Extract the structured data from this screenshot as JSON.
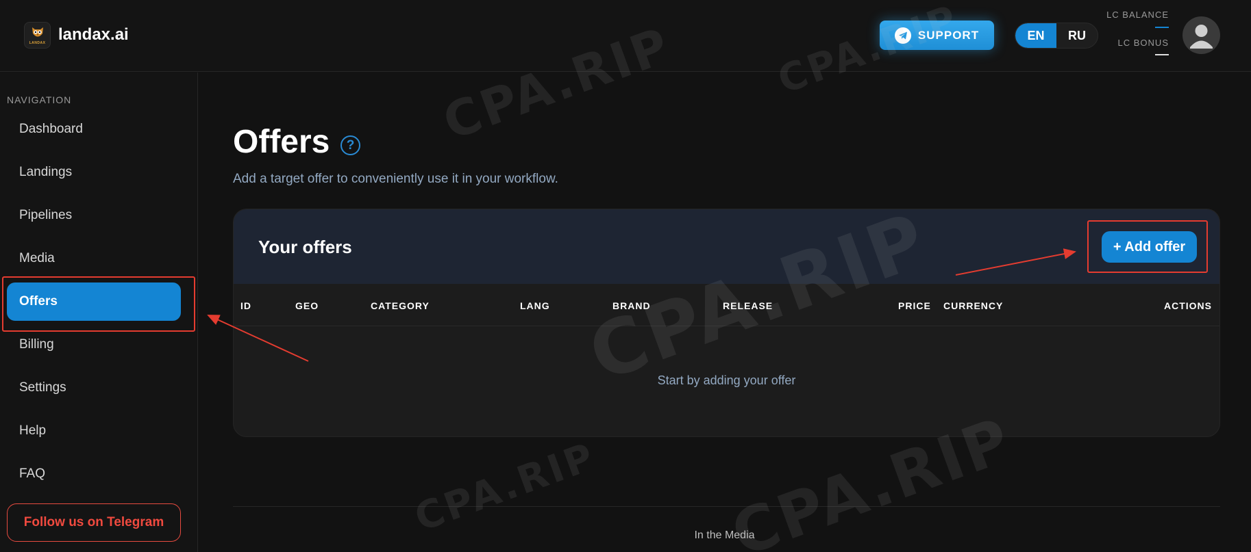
{
  "header": {
    "brand": "landax.ai",
    "logo_mini": "LANDAX",
    "support_label": "SUPPORT",
    "languages": [
      {
        "code": "EN",
        "active": true
      },
      {
        "code": "RU",
        "active": false
      }
    ],
    "lc_balance_label": "LC BALANCE",
    "lc_bonus_label": "LC BONUS"
  },
  "sidebar": {
    "title": "NAVIGATION",
    "items": [
      {
        "label": "Dashboard"
      },
      {
        "label": "Landings"
      },
      {
        "label": "Pipelines"
      },
      {
        "label": "Media"
      },
      {
        "label": "Offers",
        "active": true
      },
      {
        "label": "Billing"
      },
      {
        "label": "Settings"
      },
      {
        "label": "Help"
      },
      {
        "label": "FAQ"
      }
    ],
    "telegram_label": "Follow us on Telegram"
  },
  "main": {
    "title": "Offers",
    "help_glyph": "?",
    "subtitle": "Add a target offer to conveniently use it in your workflow.",
    "card": {
      "title": "Your offers",
      "add_button": "+ Add offer",
      "columns": [
        "ID",
        "GEO",
        "CATEGORY",
        "LANG",
        "BRAND",
        "RELEASE",
        "PRICE",
        "CURRENCY",
        "ACTIONS"
      ],
      "empty_text": "Start by adding your offer"
    }
  },
  "footer": {
    "link": "In the Media"
  },
  "watermark_text": "CPA.RIP",
  "colors": {
    "accent": "#1485d3",
    "annotation": "#e53c30",
    "telegram": "#f04a3f"
  },
  "icons": [
    "owl-logo-icon",
    "telegram-plane-icon",
    "help-icon",
    "user-avatar-icon"
  ]
}
